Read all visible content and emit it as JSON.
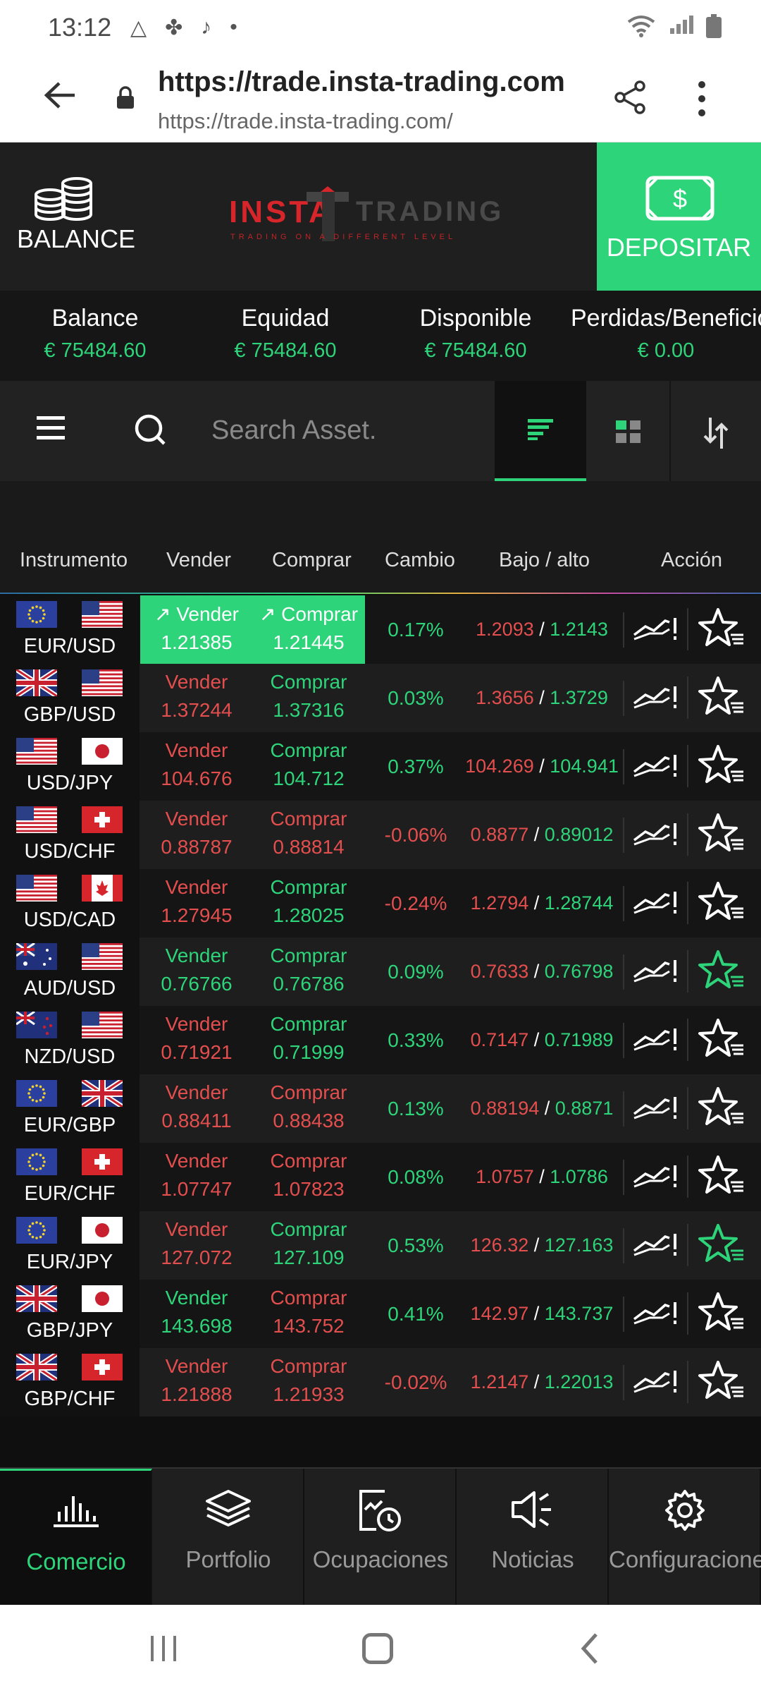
{
  "status": {
    "time": "13:12"
  },
  "browser": {
    "title": "https://trade.insta-trading.com",
    "url": "https://trade.insta-trading.com/"
  },
  "header": {
    "balance_label": "BALANCE",
    "logo_left": "INSTA",
    "logo_right": "TRADING",
    "logo_tagline": "TRADING ON A DIFFERENT LEVEL",
    "deposit_label": "DEPOSITAR",
    "accent": "#2ed47a"
  },
  "account": [
    {
      "name": "Balance",
      "value": "€ 75484.60"
    },
    {
      "name": "Equidad",
      "value": "€ 75484.60"
    },
    {
      "name": "Disponible",
      "value": "€ 75484.60"
    },
    {
      "name": "Perdidas/Beneficios",
      "value": "€ 0.00"
    }
  ],
  "search": {
    "placeholder": "Search Asset."
  },
  "columns": {
    "instrument": "Instrumento",
    "sell": "Vender",
    "buy": "Comprar",
    "change": "Cambio",
    "lowhigh": "Bajo / alto",
    "action": "Acción"
  },
  "rows": [
    {
      "pair": "EUR/USD",
      "flags": [
        "eu",
        "us"
      ],
      "sell_label": "Vender",
      "sell": "1.21385",
      "buy_label": "Comprar",
      "buy": "1.21445",
      "active": true,
      "change": "0.17%",
      "low": "1.2093",
      "high": "1.2143",
      "fav": false
    },
    {
      "pair": "GBP/USD",
      "flags": [
        "gb",
        "us"
      ],
      "sell_label": "Vender",
      "sell": "1.37244",
      "buy_label": "Comprar",
      "buy": "1.37316",
      "change": "0.03%",
      "low": "1.3656",
      "high": "1.3729",
      "fav": false
    },
    {
      "pair": "USD/JPY",
      "flags": [
        "us",
        "jp"
      ],
      "sell_label": "Vender",
      "sell": "104.676",
      "buy_label": "Comprar",
      "buy": "104.712",
      "change": "0.37%",
      "low": "104.269",
      "high": "104.941",
      "fav": false
    },
    {
      "pair": "USD/CHF",
      "flags": [
        "us",
        "ch"
      ],
      "sell_label": "Vender",
      "sell": "0.88787",
      "buy_label": "Comprar",
      "buy": "0.88814",
      "change": "-0.06%",
      "low": "0.8877",
      "high": "0.89012",
      "fav": false
    },
    {
      "pair": "USD/CAD",
      "flags": [
        "us",
        "ca"
      ],
      "sell_label": "Vender",
      "sell": "1.27945",
      "buy_label": "Comprar",
      "buy": "1.28025",
      "change": "-0.24%",
      "low": "1.2794",
      "high": "1.28744",
      "fav": false
    },
    {
      "pair": "AUD/USD",
      "flags": [
        "au",
        "us"
      ],
      "sell_label": "Vender",
      "sell": "0.76766",
      "buy_label": "Comprar",
      "buy": "0.76786",
      "change": "0.09%",
      "low": "0.7633",
      "high": "0.76798",
      "fav": true
    },
    {
      "pair": "NZD/USD",
      "flags": [
        "nz",
        "us"
      ],
      "sell_label": "Vender",
      "sell": "0.71921",
      "buy_label": "Comprar",
      "buy": "0.71999",
      "change": "0.33%",
      "low": "0.7147",
      "high": "0.71989",
      "fav": false
    },
    {
      "pair": "EUR/GBP",
      "flags": [
        "eu",
        "gb"
      ],
      "sell_label": "Vender",
      "sell": "0.88411",
      "buy_label": "Comprar",
      "buy": "0.88438",
      "change": "0.13%",
      "low": "0.88194",
      "high": "0.8871",
      "fav": false
    },
    {
      "pair": "EUR/CHF",
      "flags": [
        "eu",
        "ch"
      ],
      "sell_label": "Vender",
      "sell": "1.07747",
      "buy_label": "Comprar",
      "buy": "1.07823",
      "change": "0.08%",
      "low": "1.0757",
      "high": "1.0786",
      "fav": false
    },
    {
      "pair": "EUR/JPY",
      "flags": [
        "eu",
        "jp"
      ],
      "sell_label": "Vender",
      "sell": "127.072",
      "buy_label": "Comprar",
      "buy": "127.109",
      "change": "0.53%",
      "low": "126.32",
      "high": "127.163",
      "fav": true
    },
    {
      "pair": "GBP/JPY",
      "flags": [
        "gb",
        "jp"
      ],
      "sell_label": "Vender",
      "sell": "143.698",
      "buy_label": "Comprar",
      "buy": "143.752",
      "change": "0.41%",
      "low": "142.97",
      "high": "143.737",
      "fav": false
    },
    {
      "pair": "GBP/CHF",
      "flags": [
        "gb",
        "ch"
      ],
      "sell_label": "Vender",
      "sell": "1.21888",
      "buy_label": "Comprar",
      "buy": "1.21933",
      "change": "-0.02%",
      "low": "1.2147",
      "high": "1.22013",
      "fav": false
    }
  ],
  "colors_per_row": [
    {
      "sell": "#e34e4e",
      "buy": "#2ed47a",
      "change": "#2ed47a",
      "low": "#e34e4e",
      "high": "#2ed47a"
    },
    {
      "sell": "#e34e4e",
      "buy": "#2ed47a",
      "change": "#2ed47a",
      "low": "#e34e4e",
      "high": "#2ed47a"
    },
    {
      "sell": "#e34e4e",
      "buy": "#2ed47a",
      "change": "#2ed47a",
      "low": "#e34e4e",
      "high": "#2ed47a"
    },
    {
      "sell": "#e34e4e",
      "buy": "#e34e4e",
      "change": "#e34e4e",
      "low": "#e34e4e",
      "high": "#2ed47a"
    },
    {
      "sell": "#e34e4e",
      "buy": "#2ed47a",
      "change": "#e34e4e",
      "low": "#e34e4e",
      "high": "#2ed47a"
    },
    {
      "sell": "#2ed47a",
      "buy": "#2ed47a",
      "change": "#2ed47a",
      "low": "#e34e4e",
      "high": "#2ed47a"
    },
    {
      "sell": "#e34e4e",
      "buy": "#2ed47a",
      "change": "#2ed47a",
      "low": "#e34e4e",
      "high": "#2ed47a"
    },
    {
      "sell": "#e34e4e",
      "buy": "#e34e4e",
      "change": "#2ed47a",
      "low": "#e34e4e",
      "high": "#2ed47a"
    },
    {
      "sell": "#e34e4e",
      "buy": "#e34e4e",
      "change": "#2ed47a",
      "low": "#e34e4e",
      "high": "#2ed47a"
    },
    {
      "sell": "#e34e4e",
      "buy": "#2ed47a",
      "change": "#2ed47a",
      "low": "#e34e4e",
      "high": "#2ed47a"
    },
    {
      "sell": "#2ed47a",
      "buy": "#e34e4e",
      "change": "#2ed47a",
      "low": "#e34e4e",
      "high": "#2ed47a"
    },
    {
      "sell": "#e34e4e",
      "buy": "#e34e4e",
      "change": "#e34e4e",
      "low": "#e34e4e",
      "high": "#2ed47a"
    }
  ],
  "bottom_nav": [
    {
      "label": "Comercio",
      "icon": "bar-chart-icon",
      "active": true
    },
    {
      "label": "Portfolio",
      "icon": "layers-icon",
      "active": false
    },
    {
      "label": "Ocupaciones",
      "icon": "report-clock-icon",
      "active": false
    },
    {
      "label": "Noticias",
      "icon": "megaphone-icon",
      "active": false
    },
    {
      "label": "Configuraciones",
      "icon": "gear-icon",
      "active": false
    }
  ]
}
